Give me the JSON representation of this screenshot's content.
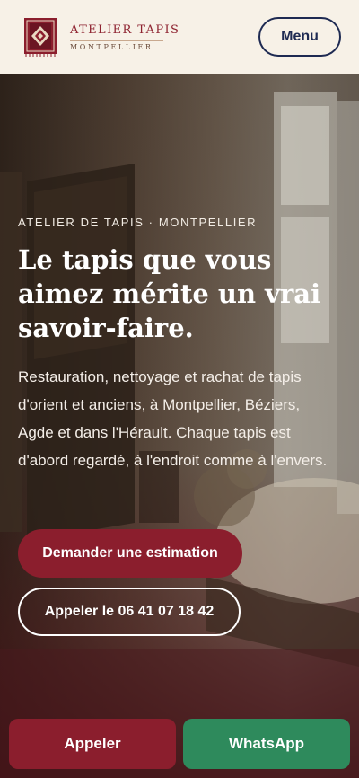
{
  "header": {
    "brand_title": "ATELIER TAPIS",
    "brand_subtitle": "MONTPELLIER",
    "menu_label": "Menu"
  },
  "hero": {
    "eyebrow": "ATELIER DE TAPIS · MONTPELLIER",
    "headline": "Le tapis que vous aimez mérite un vrai savoir-faire.",
    "intro": "Restauration, nettoyage et rachat de tapis d'orient et anciens, à Montpellier, Béziers, Agde et dans l'Hérault. Chaque tapis est d'abord regardé, à l'endroit comme à l'envers.",
    "cta_primary": "Demander une estimation",
    "cta_phone": "Appeler le 06 41 07 18 42"
  },
  "bottom_bar": {
    "call_label": "Appeler",
    "whatsapp_label": "WhatsApp"
  },
  "colors": {
    "brand_red": "#8b1e2d",
    "navy": "#1e2a52",
    "whatsapp_green": "#2e8a5c",
    "header_bg": "#f7f1e7"
  }
}
